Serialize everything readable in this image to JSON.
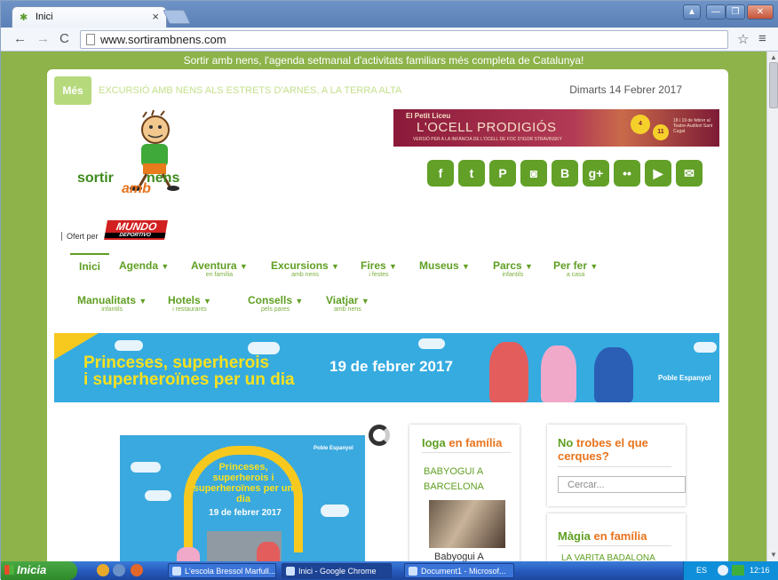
{
  "browser": {
    "tab_title": "Inici",
    "tab_close": "×",
    "url": "www.sortirambnens.com",
    "win_user": "▲",
    "win_min": "—",
    "win_max": "❐",
    "win_close": "✕"
  },
  "site": {
    "tagline": "Sortir amb nens, l'agenda setmanal d'activitats familiars més completa de Catalunya!",
    "mes_label": "Més",
    "ticker": "EXCURSIÓ AMB NENS ALS ESTRETS D'ARNES, A LA TERRA ALTA",
    "date": "Dimarts 14 Febrer 2017",
    "logo": {
      "word1": "sortir",
      "word2": "nens",
      "word3": "amb"
    },
    "top_banner": {
      "org": "El Petit Liceu",
      "title": "L'OCELL PRODIGIÓS",
      "subtitle": "VERSIÓ PER A LA INFÀNCIA DE L'OCELL DE FOC D'IGOR STRAVINSKY",
      "date1": "4",
      "date2": "11",
      "venue": "18 i 19 de febrer al Teatre-Auditori Sant Cugat"
    },
    "social": [
      {
        "glyph": "f",
        "name": "facebook-icon"
      },
      {
        "glyph": "t",
        "name": "twitter-icon"
      },
      {
        "glyph": "P",
        "name": "pinterest-icon"
      },
      {
        "glyph": "◙",
        "name": "instagram-icon"
      },
      {
        "glyph": "B",
        "name": "blogger-icon"
      },
      {
        "glyph": "g+",
        "name": "googleplus-icon"
      },
      {
        "glyph": "••",
        "name": "flickr-icon"
      },
      {
        "glyph": "▶",
        "name": "youtube-icon"
      },
      {
        "glyph": "✉",
        "name": "email-icon"
      }
    ],
    "sponsor": {
      "label": "Ofert per",
      "brand": "MUNDO",
      "brand_sub": "DEPORTIVO"
    },
    "menu": {
      "inici": "Inici",
      "row1": [
        {
          "label": "Agenda",
          "sub": ""
        },
        {
          "label": "Aventura",
          "sub": "en família"
        },
        {
          "label": "Excursions",
          "sub": "amb nens"
        },
        {
          "label": "Fires",
          "sub": "i festes"
        },
        {
          "label": "Museus",
          "sub": ""
        },
        {
          "label": "Parcs",
          "sub": "infantils"
        },
        {
          "label": "Per fer",
          "sub": "a casa"
        }
      ],
      "row2": [
        {
          "label": "Manualitats",
          "sub": "infantils"
        },
        {
          "label": "Hotels",
          "sub": "i restaurants"
        },
        {
          "label": "Consells",
          "sub": "pels pares"
        },
        {
          "label": "Viatjar",
          "sub": "amb nens"
        }
      ]
    },
    "hero": {
      "line1": "Princeses, superherois",
      "line2": "i superheroïnes per un dia",
      "date": "19 de febrer 2017",
      "brand": "Poble Espanyol"
    },
    "promo": {
      "title": "Princeses, superherois i superheroïnes per un dia",
      "date": "19 de febrer 2017",
      "brand": "Poble Espanyol"
    },
    "col1": {
      "head_a": "Ioga",
      "head_b": "en família",
      "link": "BABYOGUI A BARCELONA",
      "caption": "Babyogui A"
    },
    "col2": {
      "head_a": "No",
      "head_b": "trobes el que cerques?",
      "search_placeholder": "Cercar..."
    },
    "col3": {
      "head_a": "Màgia",
      "head_b": "en família",
      "link": "LA VARITA BADALONA"
    }
  },
  "taskbar": {
    "start": "Inicia",
    "tasks": [
      "L'escola Bressol Marfull...",
      "Inici - Google Chrome",
      "Document1 - Microsof..."
    ],
    "lang": "ES",
    "time": "12:16"
  }
}
